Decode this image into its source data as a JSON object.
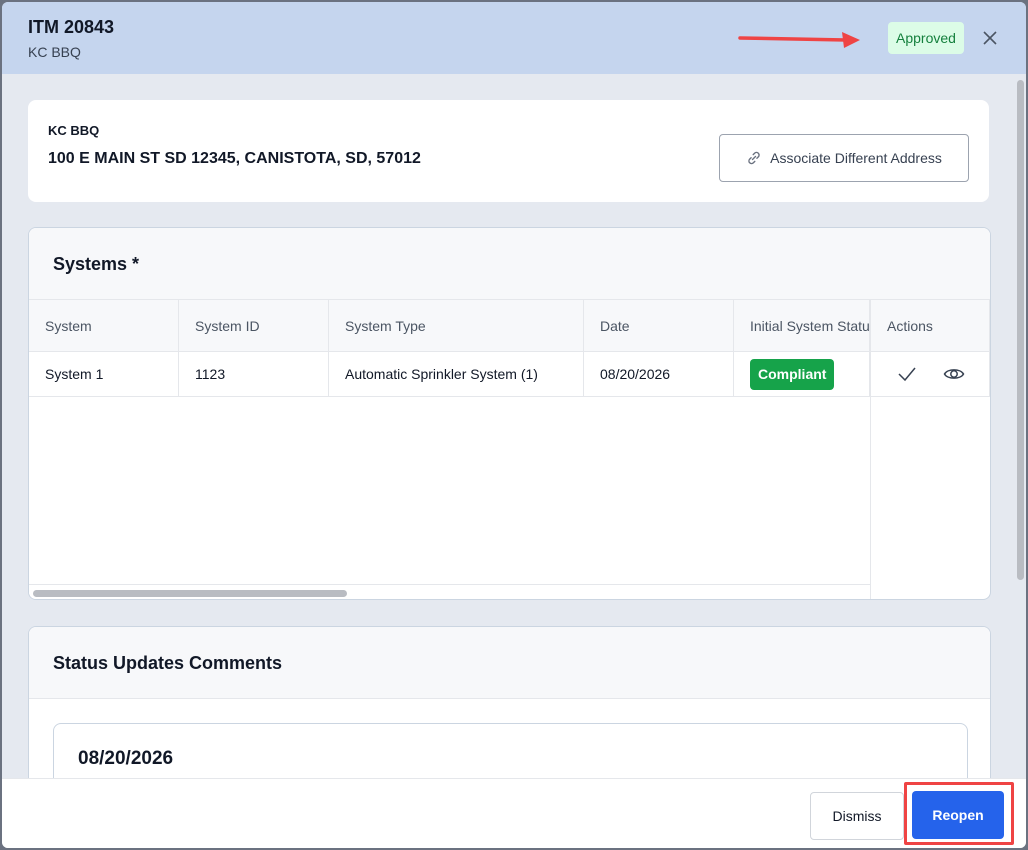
{
  "header": {
    "title": "ITM 20843",
    "subtitle": "KC BBQ",
    "status_badge": "Approved",
    "close_icon": "close-icon",
    "annotation_arrow_color": "#ef4444"
  },
  "address": {
    "name": "KC BBQ",
    "line": "100 E MAIN ST SD 12345, CANISTOTA, SD, 57012",
    "associate_button_label": "Associate Different Address",
    "associate_icon": "link-icon"
  },
  "systems": {
    "title": "Systems *",
    "columns": [
      "System",
      "System ID",
      "System Type",
      "Date",
      "Initial System Status",
      "Actions"
    ],
    "rows": [
      {
        "system": "System 1",
        "system_id": "1123",
        "system_type": "Automatic Sprinkler System (1)",
        "date": "08/20/2026",
        "status": "Compliant",
        "actions": [
          "check-icon",
          "eye-icon"
        ]
      }
    ]
  },
  "comments": {
    "title": "Status Updates Comments",
    "entries": [
      {
        "date": "08/20/2026"
      }
    ]
  },
  "footer": {
    "dismiss_label": "Dismiss",
    "reopen_label": "Reopen",
    "primary_color": "#2563eb",
    "highlight_color": "#ef4444"
  }
}
